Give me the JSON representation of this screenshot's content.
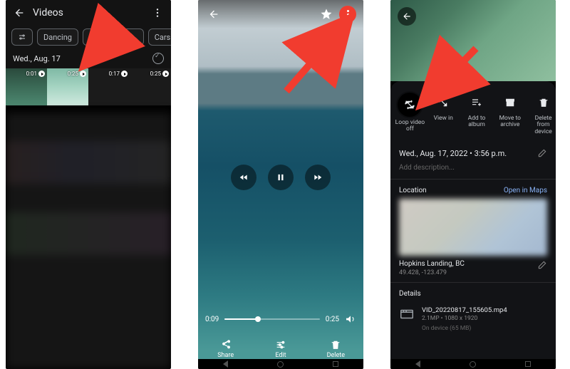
{
  "screen1": {
    "title": "Videos",
    "chips": {
      "dancing": "Dancing",
      "east_van": "East Vancouver",
      "cars": "Cars"
    },
    "date_header": "Wed., Aug. 17",
    "thumbs": {
      "d1": "0:01",
      "d2": "0:25",
      "d3": "0:17",
      "d4": "0:25"
    }
  },
  "screen2": {
    "time_elapsed": "0:09",
    "time_total": "0:25",
    "bottom": {
      "share": "Share",
      "edit": "Edit",
      "delete": "Delete"
    }
  },
  "screen3": {
    "actions": {
      "loop": "Loop video off",
      "viewin": "View in",
      "addalbum": "Add to album",
      "archive": "Move to archive",
      "delete": "Delete from device"
    },
    "timestamp": "Wed., Aug. 17, 2022 • 3:56 p.m.",
    "add_description": "Add description...",
    "location_label": "Location",
    "open_in_maps": "Open in Maps",
    "place_name": "Hopkins Landing, BC",
    "coords": "49.428, -123.479",
    "details_label": "Details",
    "filename": "VID_20220817_155605.mp4",
    "filemeta": "2.1MP • 1080 x 1920",
    "ondevice": "On device (65 MB)"
  }
}
